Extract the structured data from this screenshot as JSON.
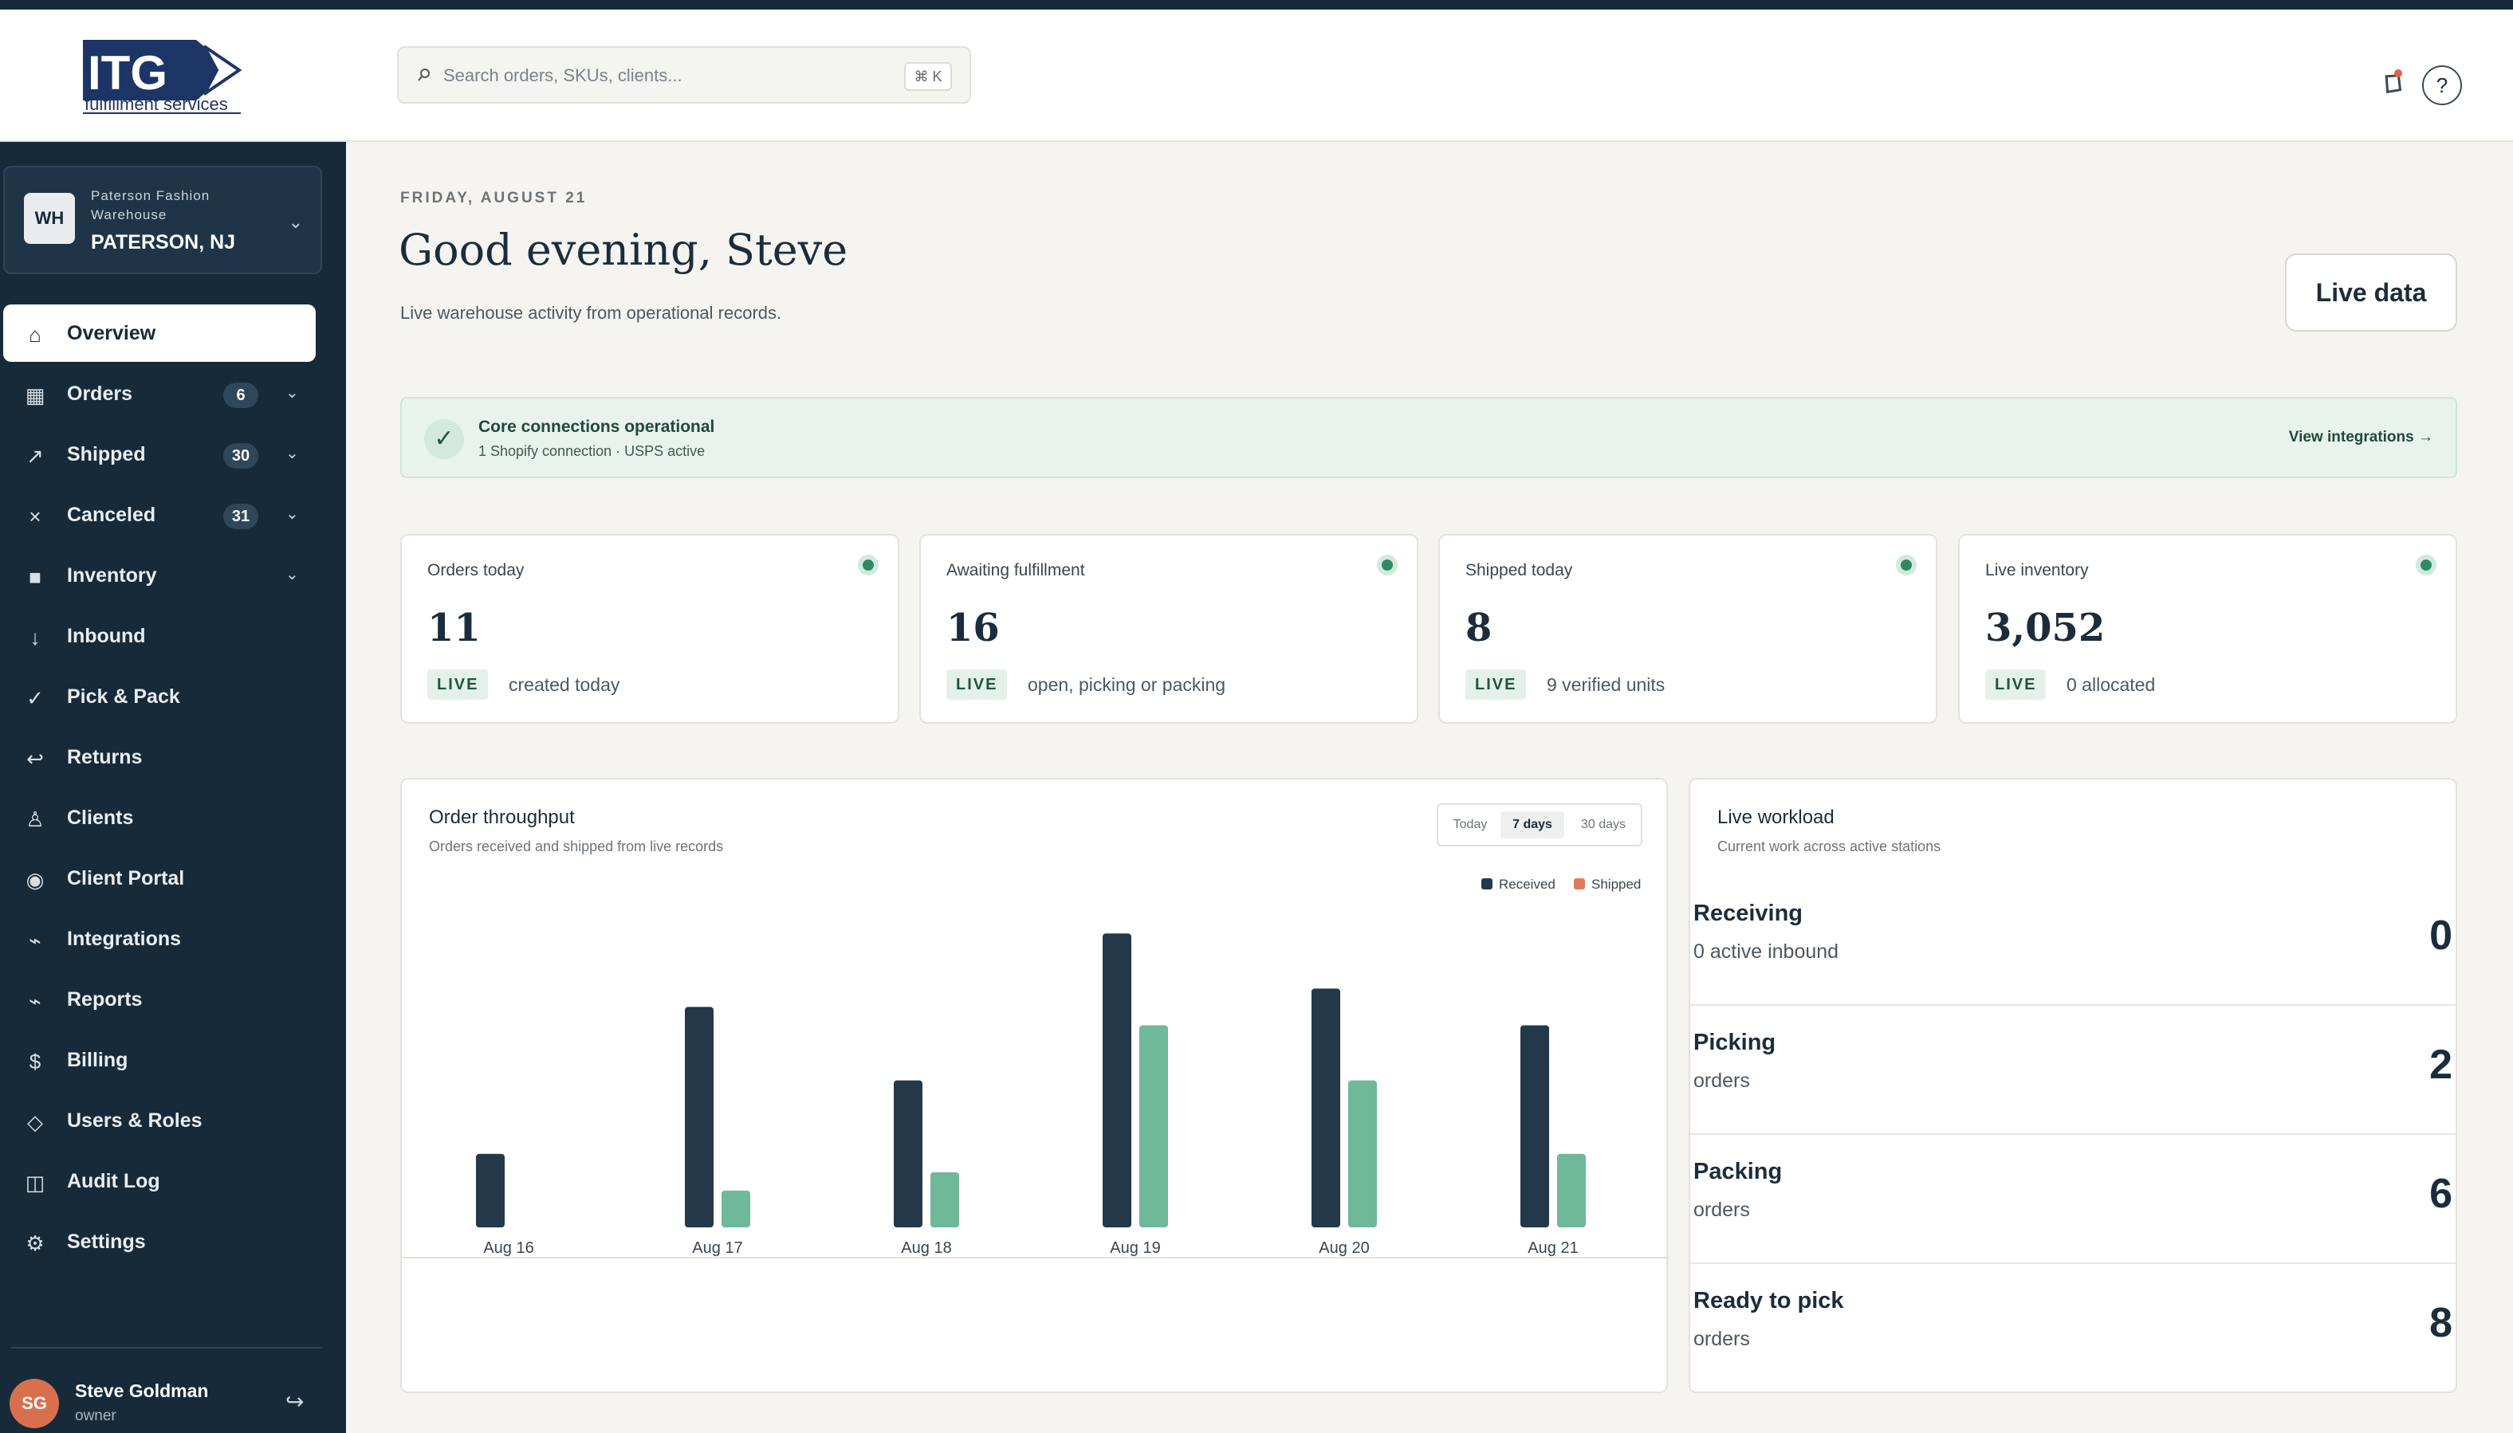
{
  "brand": {
    "logo_text": "ITG",
    "logo_sub": "fulfillment services"
  },
  "search": {
    "placeholder": "Search orders, SKUs, clients...",
    "shortcut": "⌘ K"
  },
  "header": {
    "help": "?"
  },
  "warehouse": {
    "badge": "WH",
    "name": "Paterson Fashion Warehouse",
    "city": "PATERSON, NJ"
  },
  "nav": [
    {
      "label": "Overview",
      "icon": "home-icon"
    },
    {
      "label": "Orders",
      "count": "6",
      "icon": "orders-icon"
    },
    {
      "label": "Shipped",
      "count": "30",
      "icon": "shipped-icon"
    },
    {
      "label": "Canceled",
      "count": "31",
      "icon": "canceled-icon"
    },
    {
      "label": "Inventory",
      "icon": "inventory-icon"
    },
    {
      "label": "Inbound",
      "icon": "inbound-icon"
    },
    {
      "label": "Pick & Pack",
      "icon": "check-icon"
    },
    {
      "label": "Returns",
      "icon": "return-icon"
    },
    {
      "label": "Clients",
      "icon": "clients-icon"
    },
    {
      "label": "Client Portal",
      "icon": "portal-icon"
    },
    {
      "label": "Integrations",
      "icon": "integrations-icon"
    },
    {
      "label": "Reports",
      "icon": "reports-icon"
    },
    {
      "label": "Billing",
      "icon": "dollar-icon"
    },
    {
      "label": "Users & Roles",
      "icon": "diamond-icon"
    },
    {
      "label": "Audit Log",
      "icon": "audit-icon"
    },
    {
      "label": "Settings",
      "icon": "gear-icon"
    }
  ],
  "user": {
    "initials": "SG",
    "name": "Steve Goldman",
    "role": "owner"
  },
  "page": {
    "date": "FRIDAY, AUGUST 21",
    "greeting": "Good evening, Steve",
    "subtitle": "Live warehouse activity from operational records.",
    "live_button": "Live data"
  },
  "connections": {
    "title": "Core connections operational",
    "detail": "1 Shopify connection · USPS active",
    "link": "View integrations →"
  },
  "kpis": [
    {
      "label": "Orders today",
      "value": "11",
      "badge": "LIVE",
      "note": "created today"
    },
    {
      "label": "Awaiting fulfillment",
      "value": "16",
      "badge": "LIVE",
      "note": "open, picking or packing"
    },
    {
      "label": "Shipped today",
      "value": "8",
      "badge": "LIVE",
      "note": "9 verified units"
    },
    {
      "label": "Live inventory",
      "value": "3,052",
      "badge": "LIVE",
      "note": "0 allocated"
    }
  ],
  "throughput": {
    "title": "Order throughput",
    "subtitle": "Orders received and shipped from live records",
    "ranges": [
      "Today",
      "7 days",
      "30 days"
    ],
    "selected_range": "7 days"
  },
  "chart_data": {
    "type": "bar",
    "categories": [
      "Aug 16",
      "Aug 17",
      "Aug 18",
      "Aug 19",
      "Aug 20",
      "Aug 21"
    ],
    "series": [
      {
        "name": "Received",
        "values": [
          2,
          6,
          4,
          8,
          6.5,
          5.5
        ],
        "color": "#23394a"
      },
      {
        "name": "Shipped",
        "values": [
          0,
          1,
          1.5,
          5.5,
          4,
          2
        ],
        "color": "#6fb89a"
      }
    ],
    "ylim": [
      0,
      8.2
    ],
    "legend_position": "top-right",
    "legend_swatch_shipped": "#e07a5f",
    "grid": false
  },
  "workload": {
    "title": "Live workload",
    "subtitle": "Current work across active stations",
    "rows": [
      {
        "label": "Receiving",
        "sub": "0 active inbound",
        "value": "0"
      },
      {
        "label": "Picking",
        "sub": "orders",
        "value": "2"
      },
      {
        "label": "Packing",
        "sub": "orders",
        "value": "6"
      },
      {
        "label": "Ready to pick",
        "sub": "orders",
        "value": "8"
      }
    ]
  }
}
